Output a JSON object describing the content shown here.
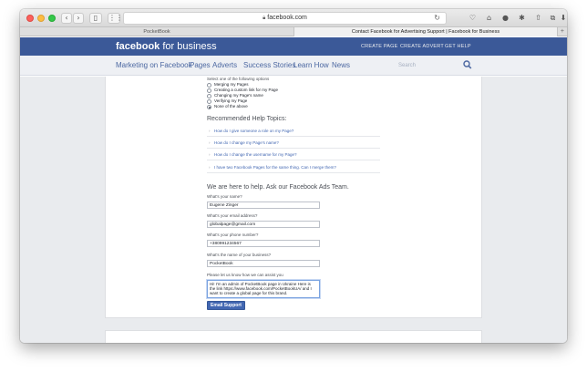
{
  "browser": {
    "url": "facebook.com",
    "tabs": [
      {
        "label": "PocketBook",
        "active": false
      },
      {
        "label": "Contact Facebook for Advertising Support | Facebook for Business",
        "active": true
      }
    ],
    "new_tab_glyph": "+",
    "icons": [
      "back-icon",
      "forward-icon",
      "sidebar-icon",
      "grid-icon",
      "lock-icon",
      "reload-icon",
      "pocket-icon",
      "home-icon",
      "extension-icon",
      "puzzle-icon",
      "share-icon",
      "tabs-icon",
      "download-icon"
    ]
  },
  "header": {
    "logo_bold": "facebook",
    "logo_light": " for business",
    "nav": [
      "CREATE PAGE",
      "CREATE ADVERT",
      "GET HELP"
    ],
    "color": "#3b5998"
  },
  "subnav": {
    "items": [
      "Marketing on Facebook",
      "Pages",
      "Adverts",
      "Success Stories",
      "Learn How",
      "News"
    ],
    "search_placeholder": "Search"
  },
  "form": {
    "options_prompt": "Select one of the following options",
    "options": [
      {
        "label": "Merging my Pages",
        "selected": false
      },
      {
        "label": "Creating a custom link for my Page",
        "selected": false
      },
      {
        "label": "Changing my Page's name",
        "selected": false
      },
      {
        "label": "Verifying my Page",
        "selected": false
      },
      {
        "label": "None of the above",
        "selected": true
      }
    ],
    "topics_heading": "Recommended Help Topics:",
    "topics": [
      "How do I give someone a role on my Page?",
      "How do I change my Page's name?",
      "How do I change the username for my Page?",
      "I have two Facebook Pages for the same thing. Can I merge them?"
    ],
    "help_heading": "We are here to help. Ask our Facebook Ads Team.",
    "fields": [
      {
        "label": "What's your name?",
        "value": "Eugene Zinger"
      },
      {
        "label": "What's your email address?",
        "value": "globalpage@gmail.com"
      },
      {
        "label": "What's your phone number?",
        "value": "+380991234567"
      },
      {
        "label": "What's the name of your business?",
        "value": "PocketBook"
      }
    ],
    "message_label": "Please let us know how we can assist you",
    "message_value": "Hi! I'm an admin of PocketBook page in Ukraine Here is the link https://www.facebook.com/PocketBookUA/ and I want to create a global page for this brand.",
    "submit_label": "Email Support"
  }
}
